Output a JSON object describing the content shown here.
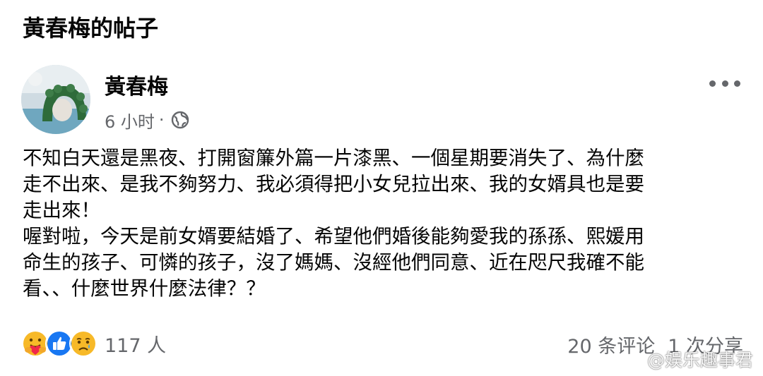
{
  "page": {
    "title": "黃春梅的帖子"
  },
  "post": {
    "author": "黃春梅",
    "timestamp": "6 小时",
    "separator": "·",
    "audience_icon": "globe-icon",
    "more_icon": "more-dots-icon",
    "body": "不知白天還是黑夜、打開窗簾外篇一片漆黑、一個星期要消失了、為什麼\n走不出來、是我不夠努力、我必須得把小女兒拉出來、我的女婿具也是要\n走出來！\n喔對啦，今天是前女婿要結婚了、希望他們婚後能夠愛我的孫孫、熙媛用\n命生的孩子、可憐的孩子，沒了媽媽、沒經他們同意、近在咫尺我確不能\n看、、什麼世界什麼法律？？"
  },
  "reactions": {
    "icons": [
      "care-icon",
      "like-icon",
      "sad-icon"
    ],
    "count_label": "117 人"
  },
  "engagement": {
    "comments_label": "20 条评论",
    "shares_label": "1 次分享"
  },
  "watermark": {
    "logo_icon": "weibo-logo-icon",
    "text": "@娱乐趣事君"
  },
  "colors": {
    "text_primary": "#050505",
    "text_secondary": "#65676b",
    "like_blue": "#1877f2",
    "reaction_yellow": "#f7b928"
  }
}
